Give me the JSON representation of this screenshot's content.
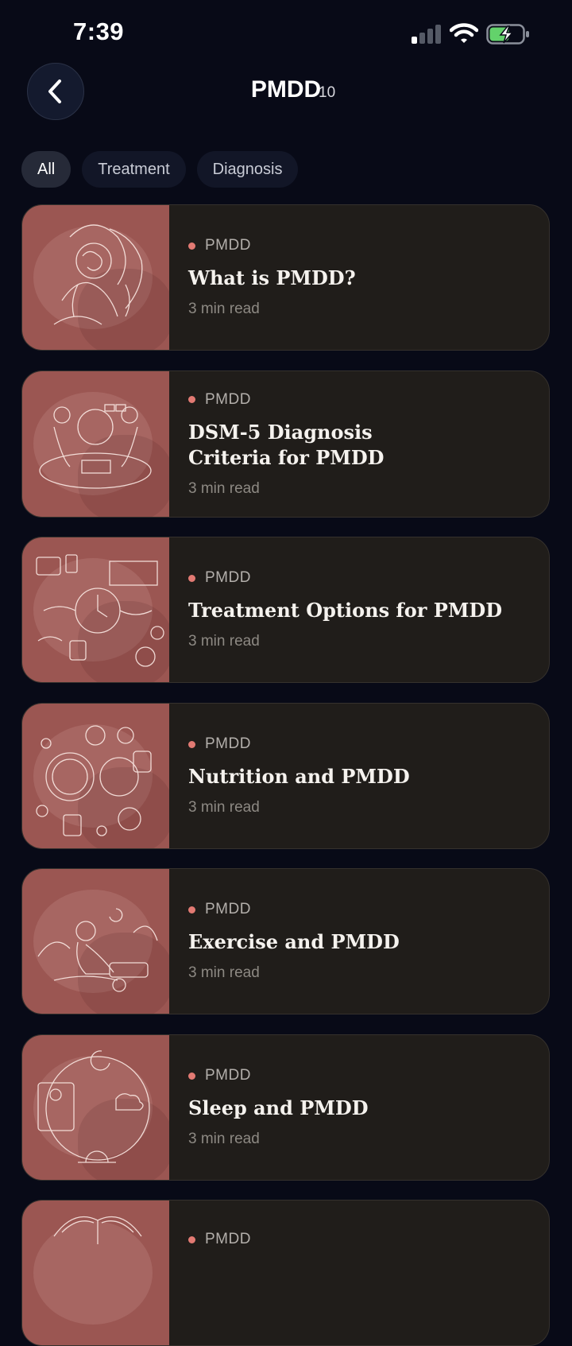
{
  "status": {
    "time": "7:39"
  },
  "header": {
    "title": "PMDD",
    "count": "10"
  },
  "filters": [
    {
      "label": "All",
      "active": true
    },
    {
      "label": "Treatment",
      "active": false
    },
    {
      "label": "Diagnosis",
      "active": false
    }
  ],
  "articles": [
    {
      "tag": "PMDD",
      "title": "What is PMDD?",
      "read_time": "3 min read",
      "illustration": "woman-brain-line-art"
    },
    {
      "tag": "PMDD",
      "title": "DSM-5 Diagnosis Criteria for PMDD",
      "read_time": "3 min read",
      "illustration": "doctor-consultation-line-art"
    },
    {
      "tag": "PMDD",
      "title": "Treatment Options for PMDD",
      "read_time": "3 min read",
      "illustration": "treatment-clock-line-art"
    },
    {
      "tag": "PMDD",
      "title": "Nutrition and PMDD",
      "read_time": "3 min read",
      "illustration": "food-plate-line-art"
    },
    {
      "tag": "PMDD",
      "title": "Exercise and PMDD",
      "read_time": "3 min read",
      "illustration": "yoga-woman-line-art"
    },
    {
      "tag": "PMDD",
      "title": "Sleep and PMDD",
      "read_time": "3 min read",
      "illustration": "sleep-cycle-line-art"
    },
    {
      "tag": "PMDD",
      "title": "",
      "read_time": "",
      "illustration": "books-line-art"
    }
  ],
  "colors": {
    "background": "#080a17",
    "card": "#201d1a",
    "thumb": "#9b5652",
    "accent_dot": "#e27a73"
  }
}
